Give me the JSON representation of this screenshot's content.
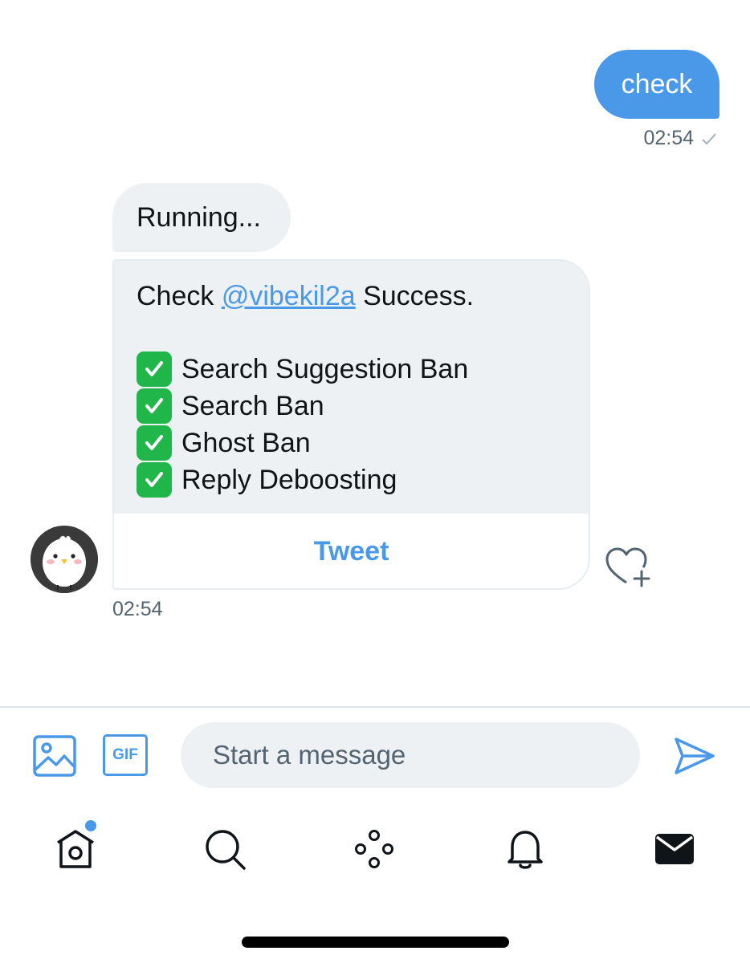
{
  "sent_message": {
    "text": "check",
    "time": "02:54",
    "status_icon": "sent-check-icon"
  },
  "received_messages": {
    "running_text": "Running...",
    "card": {
      "line1_prefix": "Check",
      "mention": "@vibekil2a",
      "line1_suffix": "Success.",
      "items": [
        "Search Suggestion Ban",
        "Search Ban",
        "Ghost Ban",
        "Reply Deboosting"
      ],
      "button_label": "Tweet"
    },
    "time": "02:54"
  },
  "composer": {
    "placeholder": "Start a message",
    "image_icon": "image-icon",
    "gif_icon": "gif-icon",
    "gif_label": "GIF",
    "send_icon": "send-icon"
  },
  "tab_bar": {
    "items": [
      "home-icon",
      "search-icon",
      "spaces-icon",
      "notifications-icon",
      "messages-icon"
    ],
    "home_has_notification_dot": true
  },
  "colors": {
    "accent": "#4a99e9",
    "bubble_gray": "#eef1f3",
    "secondary_text": "#536471",
    "check_green": "#21b64a"
  }
}
